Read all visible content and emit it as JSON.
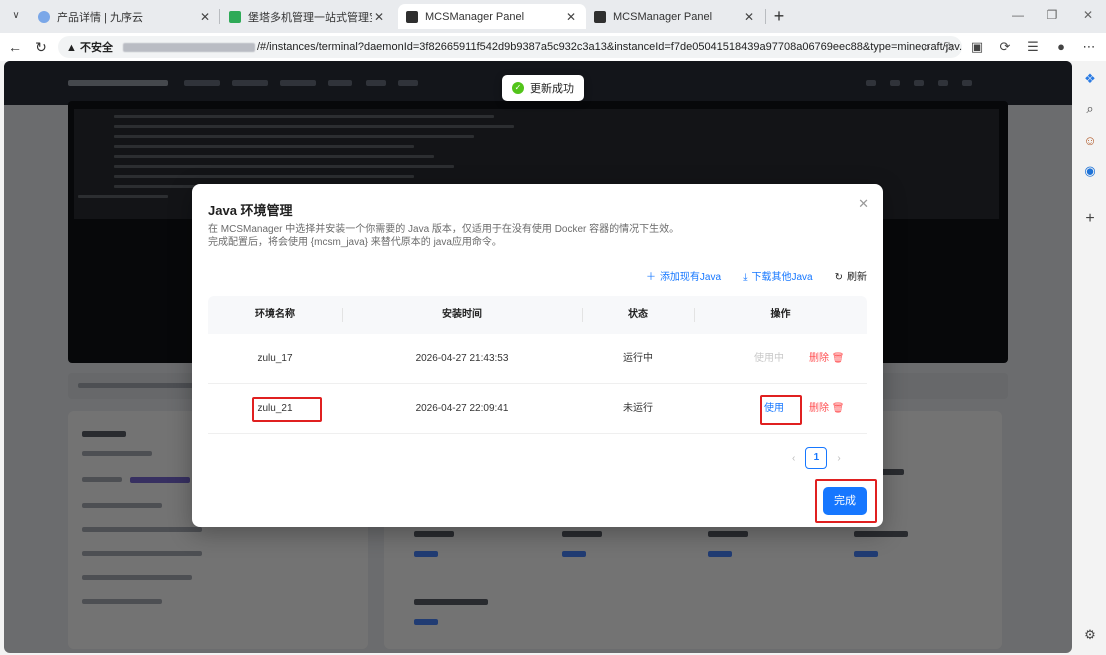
{
  "browser": {
    "tabs": [
      {
        "title": "产品详情 | 九序云",
        "fav_color": "#7aa7e8"
      },
      {
        "title": "堡塔多机管理一站式管理宝塔面板",
        "fav_color": "#2eaa57"
      },
      {
        "title": "MCSManager Panel",
        "fav_color": "#2f2f2f"
      },
      {
        "title": "MCSManager Panel",
        "fav_color": "#2f2f2f"
      }
    ],
    "url_warning": "▲ 不安全",
    "url_path": "/#/instances/terminal?daemonId=3f82665911f542d9b9387a5c932c3a13&instanceId=f7de05041518439a97708a06769eec88&type=minecraft/jav...",
    "edge_icons": [
      "copilot-icon",
      "search-icon",
      "user-icon",
      "office-icon",
      "add-icon",
      "settings-icon"
    ]
  },
  "toast": {
    "text": "更新成功"
  },
  "modal": {
    "title": "Java 环境管理",
    "desc_line1": "在 MCSManager 中选择并安装一个你需要的 Java 版本，仅适用于在没有使用 Docker 容器的情况下生效。",
    "desc_line2": "完成配置后，将会使用 {mcsm_java} 来替代原本的 java应用命令。",
    "toolbar": {
      "add": "添加现有Java",
      "download": "下载其他Java",
      "refresh": "刷新"
    },
    "columns": [
      "环境名称",
      "安装时间",
      "状态",
      "操作"
    ],
    "rows": [
      {
        "name": "zulu_17",
        "time": "2026-04-27 21:43:53",
        "status": "运行中",
        "use": "使用中",
        "delete": "删除"
      },
      {
        "name": "zulu_21",
        "time": "2026-04-27 22:09:41",
        "status": "未运行",
        "use": "使用",
        "delete": "删除"
      }
    ],
    "page": "1",
    "done": "完成"
  }
}
